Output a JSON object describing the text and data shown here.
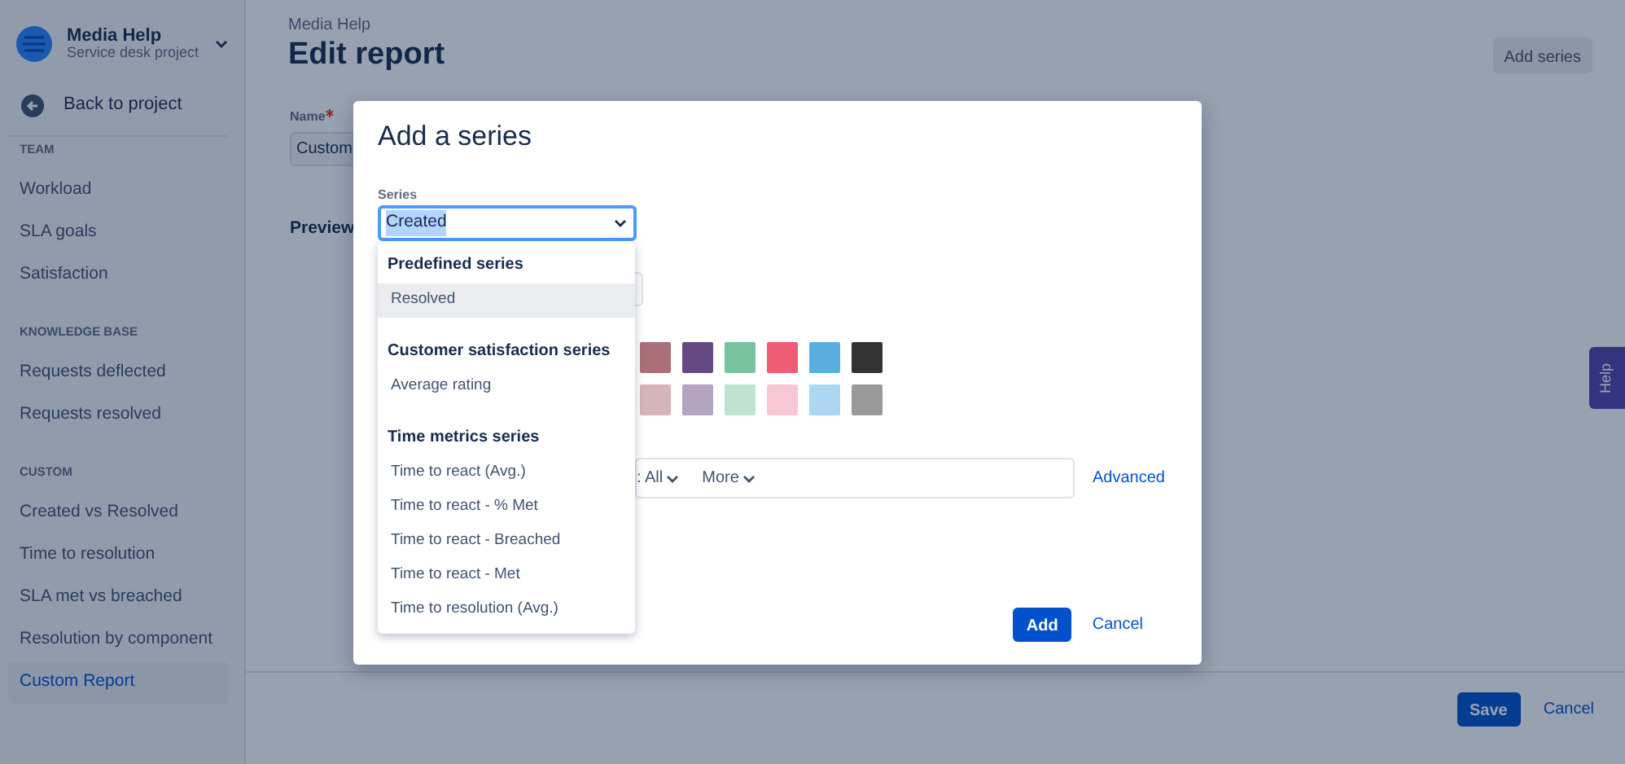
{
  "project": {
    "name": "Media Help",
    "subtitle": "Service desk project"
  },
  "back_link": "Back to project",
  "sidebar": [
    {
      "heading": "TEAM",
      "items": [
        {
          "label": "Workload",
          "selected": false
        },
        {
          "label": "SLA goals",
          "selected": false
        },
        {
          "label": "Satisfaction",
          "selected": false
        }
      ]
    },
    {
      "heading": "KNOWLEDGE BASE",
      "items": [
        {
          "label": "Requests deflected",
          "selected": false
        },
        {
          "label": "Requests resolved",
          "selected": false
        }
      ]
    },
    {
      "heading": "CUSTOM",
      "items": [
        {
          "label": "Created vs Resolved",
          "selected": false
        },
        {
          "label": "Time to resolution",
          "selected": false
        },
        {
          "label": "SLA met vs breached",
          "selected": false
        },
        {
          "label": "Resolution by component",
          "selected": false
        },
        {
          "label": "Custom Report",
          "selected": true
        }
      ]
    }
  ],
  "page": {
    "breadcrumb": "Media Help",
    "title": "Edit report",
    "add_series_button": "Add series",
    "name_field": {
      "label": "Name",
      "required": true,
      "value": "Custom"
    },
    "preview_heading": "Preview"
  },
  "footer": {
    "save_button": "Save",
    "cancel_link": "Cancel"
  },
  "help_tab": "Help",
  "modal": {
    "title": "Add a series",
    "series_label": "Series",
    "series_select": {
      "value": "Created",
      "text_highlighted": true
    },
    "dropdown": [
      {
        "heading": "Predefined series",
        "items": [
          {
            "label": "Resolved",
            "highlighted": true
          }
        ]
      },
      {
        "heading": "Customer satisfaction series",
        "items": [
          {
            "label": "Average rating",
            "highlighted": false
          }
        ]
      },
      {
        "heading": "Time metrics series",
        "items": [
          {
            "label": "Time to react (Avg.)",
            "highlighted": false
          },
          {
            "label": "Time to react - % Met",
            "highlighted": false
          },
          {
            "label": "Time to react - Breached",
            "highlighted": false
          },
          {
            "label": "Time to react - Met",
            "highlighted": false
          },
          {
            "label": "Time to resolution (Avg.)",
            "highlighted": false
          }
        ]
      }
    ],
    "swatch_rows": [
      [
        {
          "color": "#ab6f79"
        },
        {
          "color": "#654982"
        },
        {
          "color": "#79c2a0"
        },
        {
          "color": "#f15c75"
        },
        {
          "color": "#59afe1"
        },
        {
          "color": "#333333"
        }
      ],
      [
        {
          "color": "#d6b5ba"
        },
        {
          "color": "#b3a4c1"
        },
        {
          "color": "#c0e2d0"
        },
        {
          "color": "#f9c6d6"
        },
        {
          "color": "#acd6f1"
        },
        {
          "color": "#999999"
        }
      ]
    ],
    "filters": [
      ": All",
      "More"
    ],
    "advanced_link": "Advanced",
    "add_button": "Add",
    "cancel_link": "Cancel"
  }
}
